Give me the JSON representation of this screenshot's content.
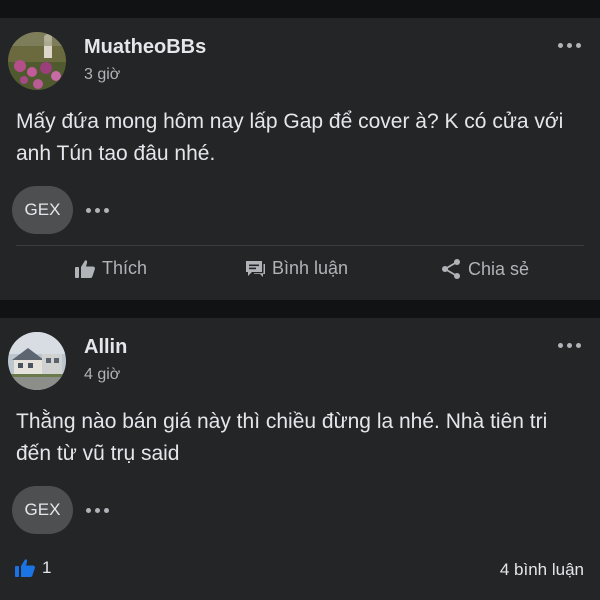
{
  "posts": [
    {
      "author": "MuatheoBBs",
      "time": "3 giờ",
      "text": "Mấy đứa mong hôm nay lấp Gap để cover à? K có cửa với anh Tún tao đâu nhé.",
      "tag": "GEX",
      "actions": {
        "like": "Thích",
        "comment": "Bình luận",
        "share": "Chia sẻ"
      }
    },
    {
      "author": "Allin",
      "time": "4 giờ",
      "text": "Thằng nào bán giá này thì chiều đừng la nhé. Nhà tiên tri đến từ vũ trụ said",
      "tag": "GEX",
      "likes": "1",
      "comments": "4 bình luận"
    }
  ],
  "colors": {
    "page_bg": "#111213",
    "card_bg": "#242526",
    "chip_bg": "#4e4f50",
    "text_primary": "#e4e6eb",
    "text_secondary": "#b0b3b8",
    "like_blue": "#1b74e4"
  },
  "icons": {
    "more": "more-horizontal-icon",
    "like": "thumbs-up-icon",
    "comment": "comment-bubble-icon",
    "share": "share-icon"
  }
}
